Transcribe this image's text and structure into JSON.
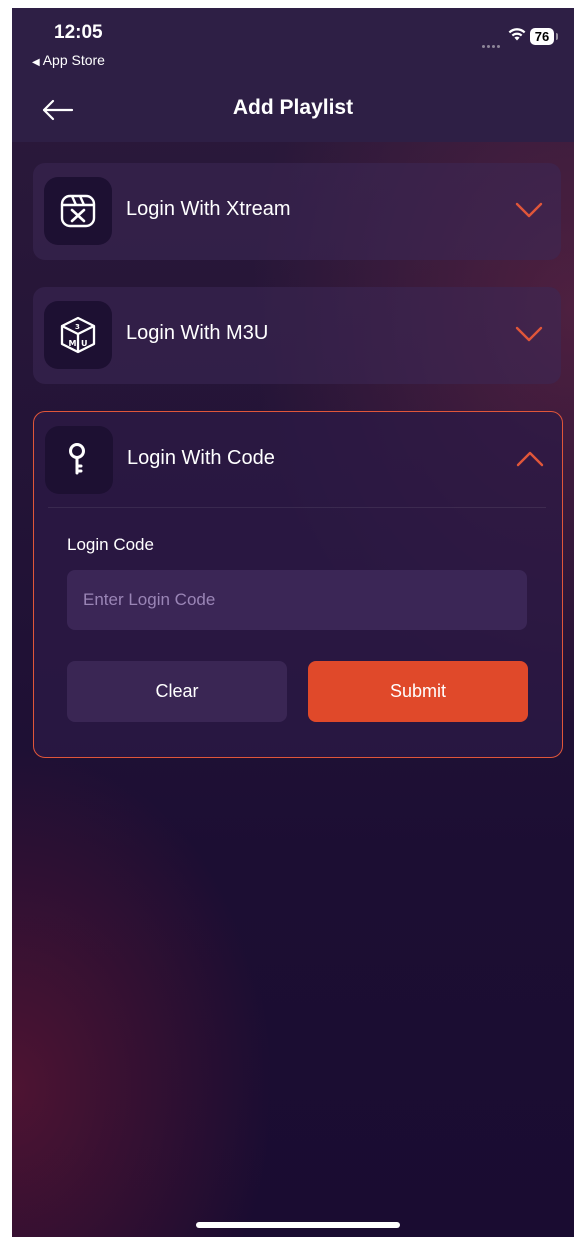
{
  "status_bar": {
    "time": "12:05",
    "back_app": "App Store",
    "battery": "76"
  },
  "header": {
    "title": "Add Playlist",
    "back_icon": "arrow-left-icon"
  },
  "login_options": [
    {
      "label": "Login With Xtream",
      "icon": "xtream-icon",
      "expanded": false
    },
    {
      "label": "Login With M3U",
      "icon": "m3u-box-icon",
      "expanded": false
    },
    {
      "label": "Login With Code",
      "icon": "key-icon",
      "expanded": true
    }
  ],
  "code_form": {
    "field_label": "Login Code",
    "placeholder": "Enter Login Code",
    "value": "",
    "clear_label": "Clear",
    "submit_label": "Submit"
  },
  "colors": {
    "accent": "#e0492a",
    "background": "#1c0e33",
    "header": "#2e1f45",
    "card": "#3c2855",
    "input": "#3b2656"
  }
}
